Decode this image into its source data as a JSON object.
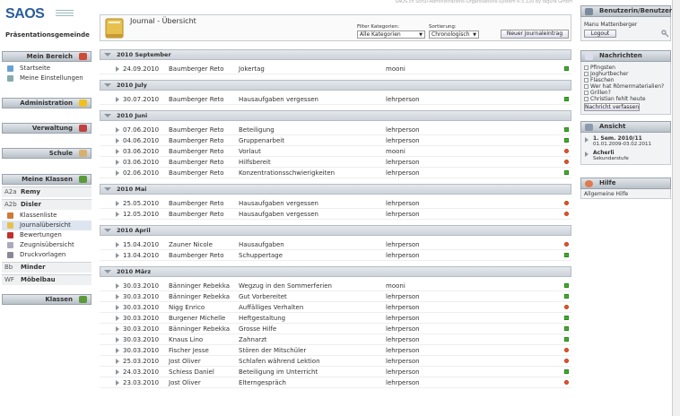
{
  "app": {
    "title": "SAOS.ch Schul-Administrations-Organisations-System 6.5.120 by digura GmbH",
    "logo": "SAOS",
    "school": "Präsentationsgemeinde"
  },
  "sidebar": {
    "mein_bereich": {
      "label": "Mein Bereich",
      "items": [
        "Startseite",
        "Meine Einstellungen"
      ]
    },
    "administration": "Administration",
    "verwaltung": "Verwaltung",
    "schule": "Schule",
    "meine_klassen": {
      "label": "Meine Klassen",
      "classes": [
        {
          "code": "A2a",
          "name": "Remy"
        },
        {
          "code": "A2b",
          "name": "Disler"
        }
      ],
      "items": [
        "Klassenliste",
        "Journalübersicht",
        "Bewertungen",
        "Zeugnisübersicht",
        "Druckvorlagen"
      ],
      "classes2": [
        {
          "code": "Bb",
          "name": "Minder"
        },
        {
          "code": "WF",
          "name": "Möbelbau"
        }
      ]
    },
    "klassen": "Klassen"
  },
  "header": {
    "title": "Journal - Übersicht",
    "filter_label": "Filter Kategorien:",
    "filter_value": "Alle Kategorien",
    "sort_label": "Sortierung:",
    "sort_value": "Chronologisch",
    "new_button": "Neuer Journaleintrag"
  },
  "months": [
    {
      "label": "2010 September",
      "rows": [
        {
          "date": "24.09.2010",
          "author": "Baumberger Reto",
          "title": "Jokertag",
          "subject": "mooni",
          "status": "green"
        }
      ]
    },
    {
      "label": "2010 July",
      "rows": [
        {
          "date": "30.07.2010",
          "author": "Baumberger Reto",
          "title": "Hausaufgaben vergessen",
          "subject": "lehrperson",
          "status": "green"
        }
      ]
    },
    {
      "label": "2010 Juni",
      "rows": [
        {
          "date": "07.06.2010",
          "author": "Baumberger Reto",
          "title": "Beteiligung",
          "subject": "lehrperson",
          "status": "green"
        },
        {
          "date": "04.06.2010",
          "author": "Baumberger Reto",
          "title": "Gruppenarbeit",
          "subject": "lehrperson",
          "status": "green"
        },
        {
          "date": "03.06.2010",
          "author": "Baumberger Reto",
          "title": "Vorlaut",
          "subject": "mooni",
          "status": "red"
        },
        {
          "date": "03.06.2010",
          "author": "Baumberger Reto",
          "title": "Hilfsbereit",
          "subject": "lehrperson",
          "status": "red"
        },
        {
          "date": "02.06.2010",
          "author": "Baumberger Reto",
          "title": "Konzentrationsschwierigkeiten",
          "subject": "lehrperson",
          "status": "green"
        }
      ]
    },
    {
      "label": "2010 Mai",
      "rows": [
        {
          "date": "25.05.2010",
          "author": "Baumberger Reto",
          "title": "Hausaufgaben vergessen",
          "subject": "lehrperson",
          "status": "red"
        },
        {
          "date": "12.05.2010",
          "author": "Baumberger Reto",
          "title": "Hausaufgaben vergessen",
          "subject": "lehrperson",
          "status": "red"
        }
      ]
    },
    {
      "label": "2010 April",
      "rows": [
        {
          "date": "15.04.2010",
          "author": "Zauner Nicole",
          "title": "Hausaufgaben",
          "subject": "lehrperson",
          "status": "red"
        },
        {
          "date": "13.04.2010",
          "author": "Baumberger Reto",
          "title": "Schuppertage",
          "subject": "lehrperson",
          "status": "green"
        }
      ]
    },
    {
      "label": "2010 März",
      "rows": [
        {
          "date": "30.03.2010",
          "author": "Bänninger Rebekka",
          "title": "Wegzug in den Sommerferien",
          "subject": "mooni",
          "status": "green"
        },
        {
          "date": "30.03.2010",
          "author": "Bänninger Rebekka",
          "title": "Gut Vorbereitet",
          "subject": "lehrperson",
          "status": "green"
        },
        {
          "date": "30.03.2010",
          "author": "Nigg Enrico",
          "title": "Auffälliges Verhalten",
          "subject": "lehrperson",
          "status": "red"
        },
        {
          "date": "30.03.2010",
          "author": "Burgener Michelle",
          "title": "Heftgestaltung",
          "subject": "lehrperson",
          "status": "green"
        },
        {
          "date": "30.03.2010",
          "author": "Bänninger Rebekka",
          "title": "Grosse Hilfe",
          "subject": "lehrperson",
          "status": "green"
        },
        {
          "date": "30.03.2010",
          "author": "Knaus Lino",
          "title": "Zahnarzt",
          "subject": "lehrperson",
          "status": "green"
        },
        {
          "date": "30.03.2010",
          "author": "Fischer Jesse",
          "title": "Stören der Mitschüler",
          "subject": "lehrperson",
          "status": "red"
        },
        {
          "date": "25.03.2010",
          "author": "Jost Oliver",
          "title": "Schlafen während Lektion",
          "subject": "lehrperson",
          "status": "red"
        },
        {
          "date": "24.03.2010",
          "author": "Schiess Daniel",
          "title": "Beteiligung im Unterricht",
          "subject": "lehrperson",
          "status": "green"
        },
        {
          "date": "23.03.2010",
          "author": "Jost Oliver",
          "title": "Elterngespräch",
          "subject": "lehrperson",
          "status": "red"
        }
      ]
    }
  ],
  "right": {
    "user": {
      "label": "Benutzerin/Benutzer",
      "name": "Manu Mattenberger",
      "logout": "Logout"
    },
    "news": {
      "label": "Nachrichten",
      "items": [
        "Pfingsten",
        "Joghurtbecher",
        "Flaschen",
        "Wer hat Römermaterialien?",
        "Grillen?",
        "Christian fehlt heute"
      ],
      "button": "Nachricht verfassen"
    },
    "view": {
      "label": "Ansicht",
      "semester": "1. Sem. 2010/11",
      "semester_dates": "01.01.2009-03.02.2011",
      "school": "Acherli",
      "level": "Sekundarstufe"
    },
    "help": {
      "label": "Hilfe",
      "item": "Allgemeine Hilfe"
    }
  },
  "colors": {
    "accent": "#2a5d9c",
    "ok": "#3fae2a",
    "warn": "#e8542a"
  }
}
